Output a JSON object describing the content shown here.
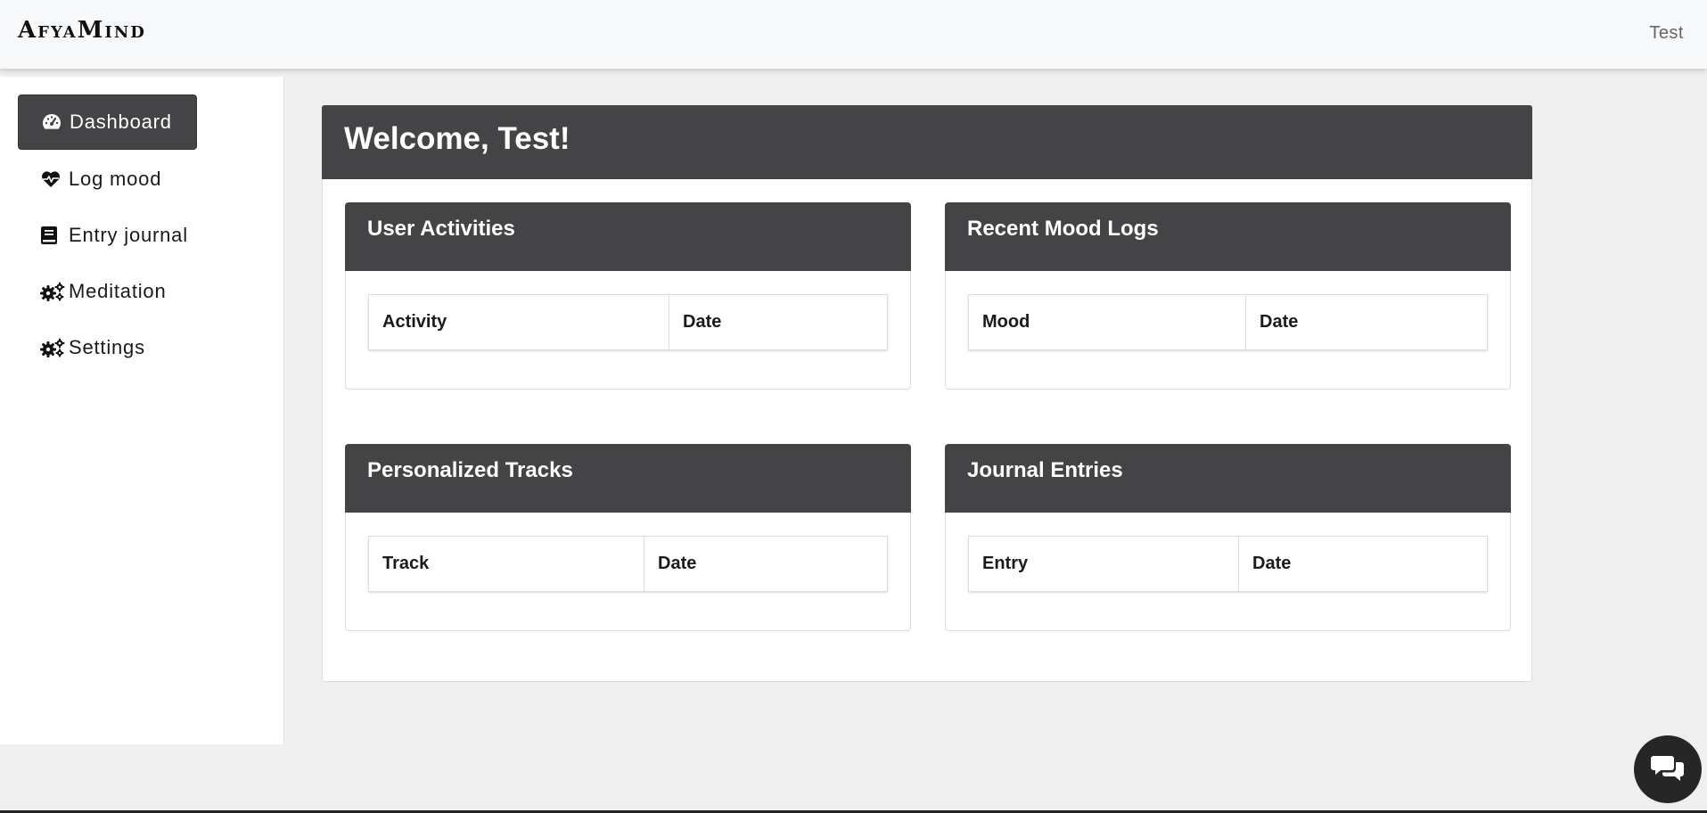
{
  "topbar": {
    "brand": "AfyaMind",
    "user": "Test"
  },
  "sidebar": {
    "items": [
      {
        "label": "Dashboard",
        "icon": "dashboard-gauge-icon",
        "active": true
      },
      {
        "label": "Log mood",
        "icon": "heart-pulse-icon",
        "active": false
      },
      {
        "label": "Entry journal",
        "icon": "book-icon",
        "active": false
      },
      {
        "label": "Meditation",
        "icon": "gears-icon",
        "active": false
      },
      {
        "label": "Settings",
        "icon": "gears-icon",
        "active": false
      }
    ]
  },
  "main": {
    "welcome": "Welcome, Test!",
    "cards": [
      {
        "title": "User Activities",
        "columns": [
          "Activity",
          "Date"
        ]
      },
      {
        "title": "Recent Mood Logs",
        "columns": [
          "Mood",
          "Date"
        ]
      },
      {
        "title": "Personalized Tracks",
        "columns": [
          "Track",
          "Date"
        ]
      },
      {
        "title": "Journal Entries",
        "columns": [
          "Entry",
          "Date"
        ]
      }
    ]
  },
  "chat": {
    "icon": "chat-bubbles-icon"
  },
  "colors": {
    "header_dark": "#444446",
    "background": "#efefef",
    "topbar": "#f7f8fa"
  }
}
